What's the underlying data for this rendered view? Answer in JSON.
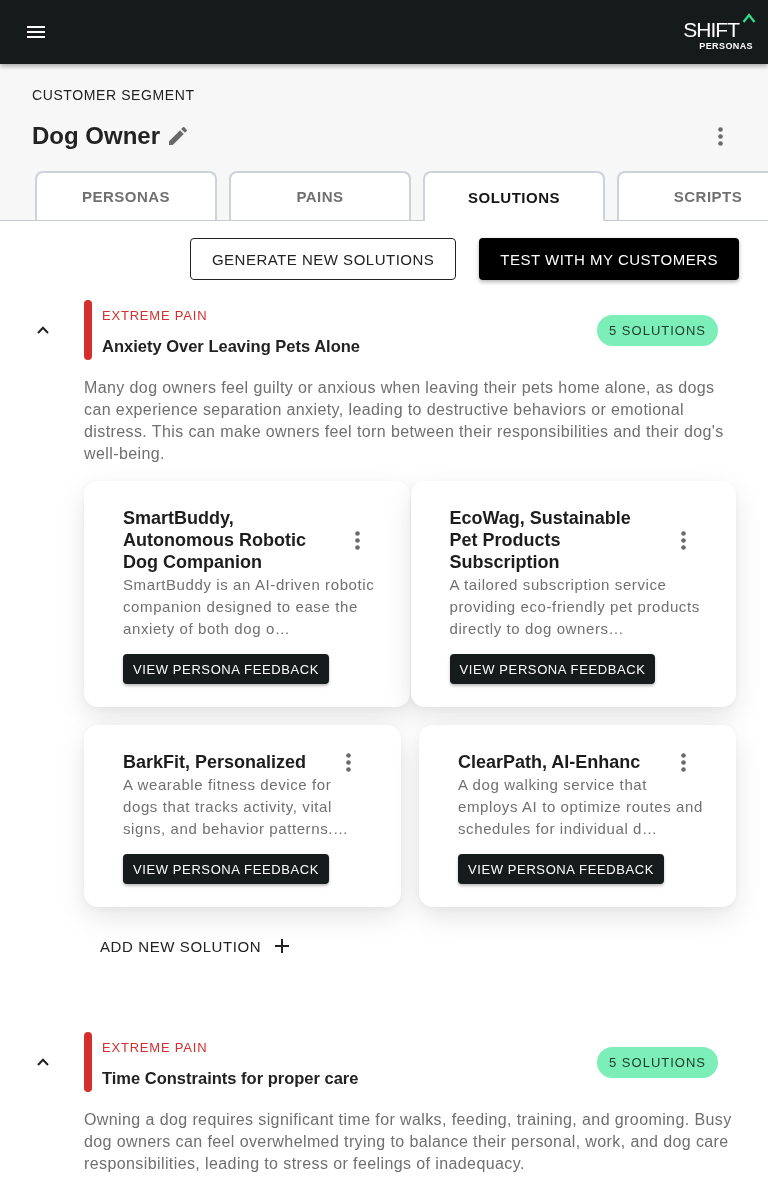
{
  "top_bar": {
    "logo_wordmark": "SHIFT",
    "logo_subtitle": "PERSONAS"
  },
  "segment": {
    "eyebrow": "CUSTOMER SEGMENT",
    "title": "Dog Owner"
  },
  "tabs": [
    {
      "label": "PERSONAS",
      "selected": false
    },
    {
      "label": "PAINS",
      "selected": false
    },
    {
      "label": "SOLUTIONS",
      "selected": true
    },
    {
      "label": "SCRIPTS",
      "selected": false
    }
  ],
  "actions": [
    {
      "label": "GENERATE NEW SOLUTIONS",
      "kind": "outlined"
    },
    {
      "label": "TEST WITH MY CUSTOMERS",
      "kind": "filled"
    }
  ],
  "pains": [
    {
      "severity": "EXTREME PAIN",
      "color": "#d32f2f",
      "title": "Anxiety Over Leaving Pets Alone",
      "badge": "5 SOLUTIONS",
      "expanded": true,
      "description": "Many dog owners feel guilty or anxious when leaving their pets home alone, as dogs can experience separation anxiety, leading to destructive behaviors or emotional distress. This can make owners feel torn between their responsibilities and their dog's well-being.",
      "solutions": [
        {
          "title": "SmartBuddy, Autonomous Robotic Dog Companion",
          "description": "SmartBuddy is an AI-driven robotic companion designed to ease the anxiety of both dog o…",
          "action": "VIEW PERSONA FEEDBACK"
        },
        {
          "title": "EcoWag, Sustainable Pet Products Subscription",
          "description": "A tailored subscription service providing eco-friendly pet products directly to dog owners…",
          "action": "VIEW PERSONA FEEDBACK"
        },
        {
          "title": "BarkFit, Personalized",
          "description": "A wearable fitness device for dogs that tracks activity, vital signs, and behavior patterns.…",
          "action": "VIEW PERSONA FEEDBACK"
        },
        {
          "title": "ClearPath, AI-Enhanc",
          "description": "A dog walking service that employs AI to optimize routes and schedules for individual d…",
          "action": "VIEW PERSONA FEEDBACK"
        }
      ],
      "add_label": "ADD NEW SOLUTION"
    },
    {
      "severity": "EXTREME PAIN",
      "color": "#d32f2f",
      "title": "Time Constraints for proper care",
      "badge": "5 SOLUTIONS",
      "expanded": true,
      "description": "Owning a dog requires significant time for walks, feeding, training, and grooming. Busy dog owners can feel overwhelmed trying to balance their personal, work, and dog care responsibilities, leading to stress or feelings of inadequacy."
    }
  ]
}
